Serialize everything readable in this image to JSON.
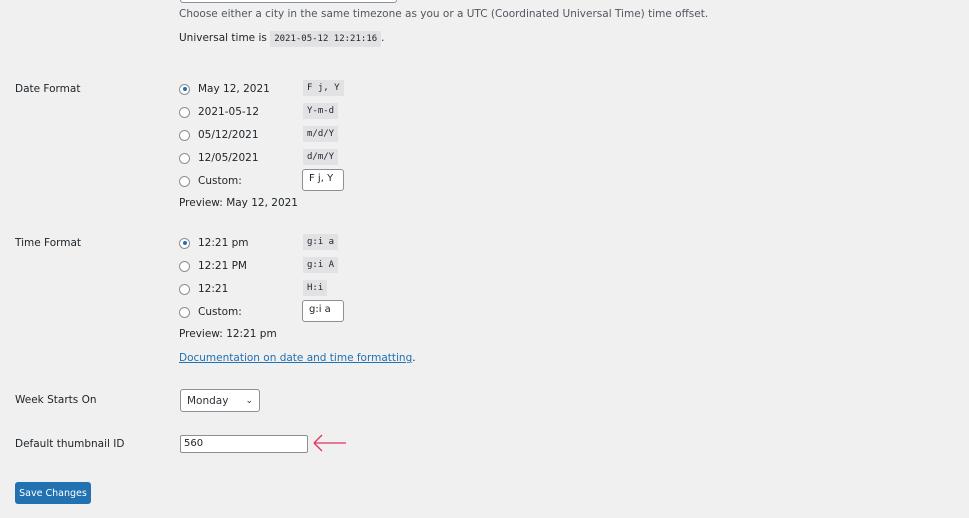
{
  "timezone": {
    "help": "Choose either a city in the same timezone as you or a UTC (Coordinated Universal Time) time offset.",
    "universal_prefix": "Universal time is",
    "universal_value": "2021-05-12 12:21:16",
    "universal_suffix": "."
  },
  "date_format": {
    "label": "Date Format",
    "options": [
      {
        "label": "May 12, 2021",
        "format": "F j, Y",
        "checked": true
      },
      {
        "label": "2021-05-12",
        "format": "Y-m-d",
        "checked": false
      },
      {
        "label": "05/12/2021",
        "format": "m/d/Y",
        "checked": false
      },
      {
        "label": "12/05/2021",
        "format": "d/m/Y",
        "checked": false
      }
    ],
    "custom_label": "Custom:",
    "custom_value": "F j, Y",
    "preview_label": "Preview:",
    "preview_value": "May 12, 2021"
  },
  "time_format": {
    "label": "Time Format",
    "options": [
      {
        "label": "12:21 pm",
        "format": "g:i a",
        "checked": true
      },
      {
        "label": "12:21 PM",
        "format": "g:i A",
        "checked": false
      },
      {
        "label": "12:21",
        "format": "H:i",
        "checked": false
      }
    ],
    "custom_label": "Custom:",
    "custom_value": "g:i a",
    "preview_label": "Preview:",
    "preview_value": "12:21 pm",
    "doc_link": "Documentation on date and time formatting",
    "doc_suffix": "."
  },
  "week_starts": {
    "label": "Week Starts On",
    "value": "Monday"
  },
  "thumbnail": {
    "label": "Default thumbnail ID",
    "value": "560",
    "arrow_color": "#e0335a"
  },
  "save_label": "Save Changes"
}
